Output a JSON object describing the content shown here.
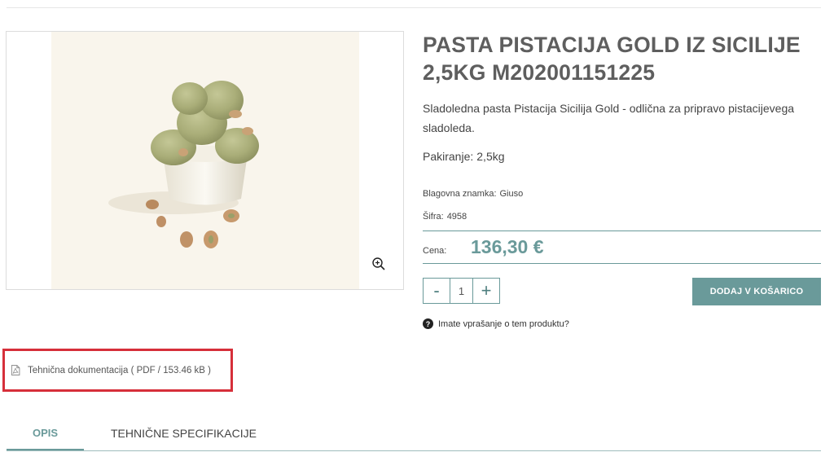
{
  "product": {
    "title": "PASTA PISTACIJA GOLD IZ SICILIJE 2,5KG M202001151225",
    "short_description": "Sladoledna pasta Pistacija Sicilija Gold - odlična za pripravo pistacijevega sladoleda.",
    "packaging_label": "Pakiranje:",
    "packaging_value": "2,5kg",
    "brand_label": "Blagovna znamka:",
    "brand_value": "Giuso",
    "sku_label": "Šifra:",
    "sku_value": "4958",
    "image_icons": {
      "zoom": "zoom-in-icon"
    }
  },
  "price": {
    "label": "Cena:",
    "value": "136,30 €",
    "color": "#6a9a9a"
  },
  "cart": {
    "minus_label": "-",
    "quantity": "1",
    "plus_label": "+",
    "add_button_label": "DODAJ V KOŠARICO",
    "button_color": "#6a9a9a"
  },
  "question": {
    "icon": "question-circle-icon",
    "text": "Imate vprašanje o tem produktu?"
  },
  "documentation": {
    "icon": "pdf-file-icon",
    "link_text": "Tehnična dokumentacija ( PDF / 153.46 kB )",
    "highlight_color": "#d62f3a"
  },
  "tabs": [
    {
      "label": "OPIS",
      "active": true
    },
    {
      "label": "TEHNIČNE SPECIFIKACIJE",
      "active": false
    }
  ]
}
